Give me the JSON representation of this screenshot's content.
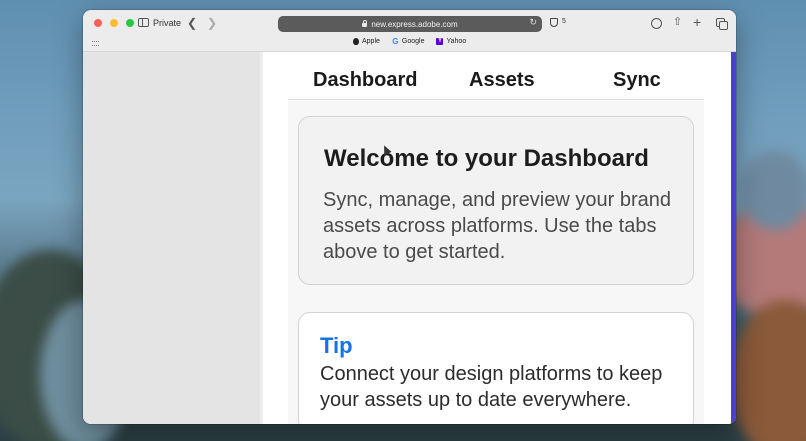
{
  "browser": {
    "private_label": "Private",
    "address": "new.express.adobe.com",
    "shield_count": "5",
    "bookmarks": [
      {
        "label": "Apple",
        "icon": "apple-logo-icon"
      },
      {
        "label": "Google",
        "icon": "google-logo-icon"
      },
      {
        "label": "Yahoo",
        "icon": "yahoo-logo-icon"
      }
    ]
  },
  "app": {
    "tabs": [
      "Dashboard",
      "Assets",
      "Sync"
    ],
    "welcome": {
      "title": "Welcome to your Dashboard",
      "body": "Sync, manage, and preview your brand assets across platforms. Use the tabs above to get started."
    },
    "tip": {
      "title": "Tip",
      "body": "Connect your design platforms to keep your assets up to date everywhere."
    }
  },
  "colors": {
    "accent": "#1473e6",
    "side_accent": "#4a3fcf"
  }
}
